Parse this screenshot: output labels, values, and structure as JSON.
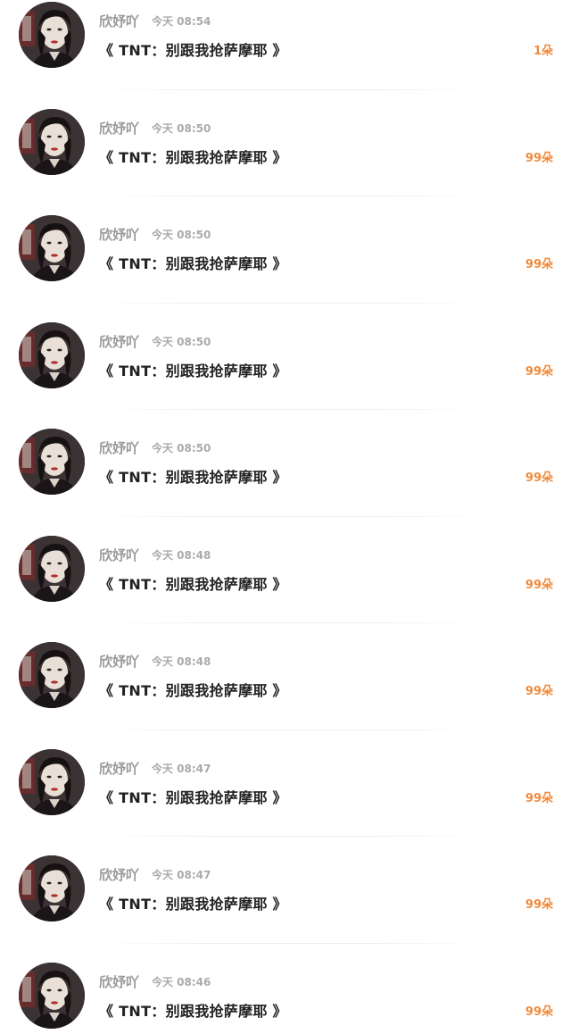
{
  "items": [
    {
      "user": "欣妤吖",
      "time": "今天 08:54",
      "title": "《 TNT：别跟我抢萨摩耶 》",
      "gift": "1朵"
    },
    {
      "user": "欣妤吖",
      "time": "今天 08:50",
      "title": "《 TNT：别跟我抢萨摩耶 》",
      "gift": "99朵"
    },
    {
      "user": "欣妤吖",
      "time": "今天 08:50",
      "title": "《 TNT：别跟我抢萨摩耶 》",
      "gift": "99朵"
    },
    {
      "user": "欣妤吖",
      "time": "今天 08:50",
      "title": "《 TNT：别跟我抢萨摩耶 》",
      "gift": "99朵"
    },
    {
      "user": "欣妤吖",
      "time": "今天 08:50",
      "title": "《 TNT：别跟我抢萨摩耶 》",
      "gift": "99朵"
    },
    {
      "user": "欣妤吖",
      "time": "今天 08:48",
      "title": "《 TNT：别跟我抢萨摩耶 》",
      "gift": "99朵"
    },
    {
      "user": "欣妤吖",
      "time": "今天 08:48",
      "title": "《 TNT：别跟我抢萨摩耶 》",
      "gift": "99朵"
    },
    {
      "user": "欣妤吖",
      "time": "今天 08:47",
      "title": "《 TNT：别跟我抢萨摩耶 》",
      "gift": "99朵"
    },
    {
      "user": "欣妤吖",
      "time": "今天 08:47",
      "title": "《 TNT：别跟我抢萨摩耶 》",
      "gift": "99朵"
    },
    {
      "user": "欣妤吖",
      "time": "今天 08:46",
      "title": "《 TNT：别跟我抢萨摩耶 》",
      "gift": "99朵"
    }
  ],
  "colors": {
    "accent": "#f08a3c",
    "username": "#9a9a9a",
    "time": "#aaaaaa",
    "title": "#222222",
    "divider": "#eeeeee"
  },
  "icons": {
    "avatar": "user-avatar-photo"
  }
}
